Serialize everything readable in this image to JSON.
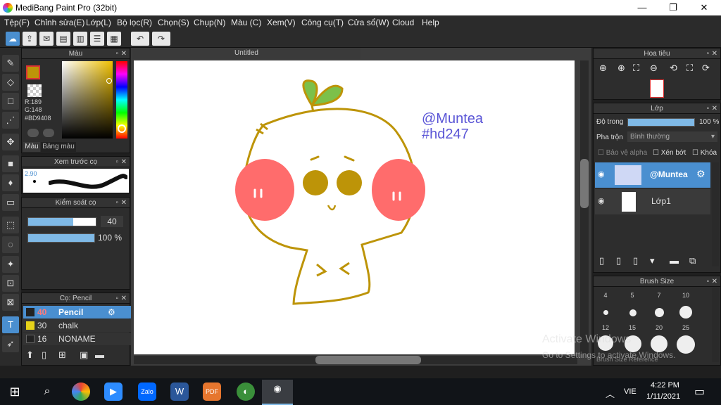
{
  "window": {
    "title": "MediBang Paint Pro (32bit)",
    "minimize": "—",
    "maximize": "❐",
    "close": "✕"
  },
  "menu": [
    "Tệp(F)",
    "Chỉnh sửa(E)",
    "Lớp(L)",
    "Bộ lọc(R)",
    "Chọn(S)",
    "Chụp(N)",
    "Màu (C)",
    "Xem(V)",
    "Công cụ(T)",
    "Cửa sổ(W)",
    "Cloud",
    "Help"
  ],
  "color_panel": {
    "title": "Màu",
    "r": "R:189",
    "g": "G:148",
    "hex": "#BD9408",
    "tab_color": "Màu",
    "tab_palette": "Bảng màu",
    "fg": "#BD9408"
  },
  "brush_preview": {
    "title": "Xem trước cọ",
    "size": "2.90"
  },
  "brush_control": {
    "title": "Kiểm soát cọ",
    "size_value": "40",
    "opacity_value": "100 %",
    "size_fraction": 0.67,
    "opacity_fraction": 1.0
  },
  "brush_panel": {
    "title": "Cọ: Pencil",
    "items": [
      {
        "size": "40",
        "name": "Pencil",
        "color": "#222"
      },
      {
        "size": "30",
        "name": "chalk",
        "color": "#e6d21a"
      },
      {
        "size": "16",
        "name": "NONAME",
        "color": "#222"
      }
    ]
  },
  "canvas": {
    "tab": "Untitled",
    "text_line1": "@Muntea",
    "text_line2": "#hd247"
  },
  "navigator": {
    "title": "Hoa tiêu"
  },
  "layer_panel": {
    "title": "Lớp",
    "opacity_label": "Độ trong",
    "opacity_value": "100 %",
    "opacity_fraction": 1.0,
    "blend_label": "Pha trộn",
    "blend_value": "Bình thường",
    "protect_alpha": "Bảo vệ alpha",
    "clipping": "Xén bớt",
    "lock": "Khóa",
    "layers": [
      {
        "name": "@Muntea",
        "selected": true
      },
      {
        "name": "Lớp1",
        "selected": false
      }
    ]
  },
  "brush_size": {
    "title": "Brush Size",
    "sizes_top": [
      "4",
      "5",
      "7",
      "10"
    ],
    "sizes_mid": [
      "12",
      "15",
      "20",
      "25"
    ],
    "footer": "Brush Size  Reference"
  },
  "watermark": {
    "line1": "Activate Windows",
    "line2": "Go to Settings to activate Windows."
  },
  "taskbar": {
    "lang": "VIE",
    "time": "4:22 PM",
    "date": "1/11/2021"
  }
}
